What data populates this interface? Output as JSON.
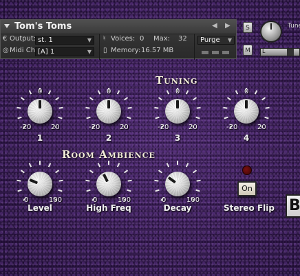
{
  "header": {
    "instrument_name": "Tom's Toms",
    "prev_arrow": "◀",
    "next_arrow": "▶",
    "output_label": "Output:",
    "output_value": "st. 1",
    "voices_label": "Voices:",
    "voices_value": "0",
    "max_label": "Max:",
    "max_value": "32",
    "purge_label": "Purge",
    "midi_label": "Midi Ch:",
    "midi_value": "[A]  1",
    "memory_label": "Memory:",
    "memory_value": "16.57 MB"
  },
  "side": {
    "solo_label": "S",
    "mute_label": "M",
    "tune_label": "Tune",
    "pan_label": "L"
  },
  "tuning": {
    "title": "Tuning",
    "knobs": [
      {
        "name": "1",
        "min": "-20",
        "max": "20",
        "center": "0",
        "value": 0
      },
      {
        "name": "2",
        "min": "-20",
        "max": "20",
        "center": "0",
        "value": 0
      },
      {
        "name": "3",
        "min": "-20",
        "max": "20",
        "center": "0",
        "value": 0
      },
      {
        "name": "4",
        "min": "-20",
        "max": "20",
        "center": "0",
        "value": 0
      }
    ]
  },
  "ambience": {
    "title": "Room Ambience",
    "knobs": [
      {
        "name": "Level",
        "min": "0",
        "max": "100",
        "value": 25
      },
      {
        "name": "High Freq",
        "min": "0",
        "max": "100",
        "value": 40
      },
      {
        "name": "Decay",
        "min": "0",
        "max": "100",
        "value": 30
      }
    ],
    "stereo_flip_label": "Stereo Flip",
    "stereo_flip_button": "On"
  },
  "partial_button": "B"
}
